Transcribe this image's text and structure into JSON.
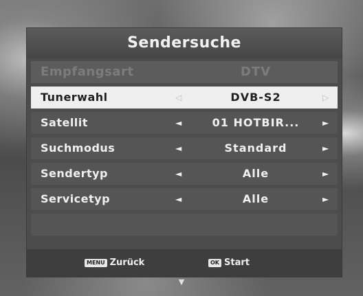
{
  "title": "Sendersuche",
  "rows": [
    {
      "label": "Empfangsart",
      "value": "DTV",
      "state": "disabled"
    },
    {
      "label": "Tunerwahl",
      "value": "DVB-S2",
      "state": "selected"
    },
    {
      "label": "Satellit",
      "value": "01 HOTBIR...",
      "state": "normal"
    },
    {
      "label": "Suchmodus",
      "value": "Standard",
      "state": "normal"
    },
    {
      "label": "Sendertyp",
      "value": "Alle",
      "state": "normal"
    },
    {
      "label": "Servicetyp",
      "value": "Alle",
      "state": "normal"
    }
  ],
  "arrows": {
    "left": "◄",
    "right": "►",
    "left_outline": "◁",
    "right_outline": "▷",
    "down": "▼"
  },
  "footer": {
    "back_key": "MENU",
    "back_label": "Zurück",
    "start_key": "OK",
    "start_label": "Start"
  },
  "colors": {
    "panel": "#4c4c4c",
    "selected_row": "#efefef",
    "row": "#555555",
    "footer": "#3e3e3e"
  }
}
